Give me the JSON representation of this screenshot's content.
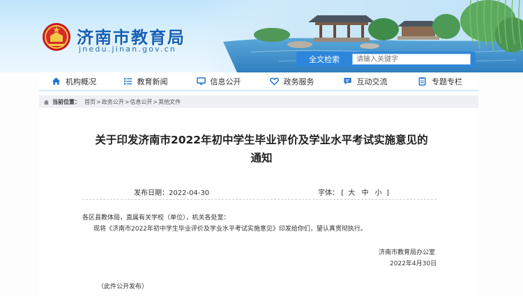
{
  "header": {
    "site_title": "济南市教育局",
    "site_domain": "jnedu.jinan.gov.cn",
    "search_label": "全文检索",
    "search_placeholder": "请输入关键字"
  },
  "nav": {
    "items": [
      {
        "label": "机构概况",
        "icon": "home-icon"
      },
      {
        "label": "教育新闻",
        "icon": "list-icon"
      },
      {
        "label": "信息公开",
        "icon": "monitor-icon"
      },
      {
        "label": "政务服务",
        "icon": "heart-icon"
      },
      {
        "label": "互动交流",
        "icon": "chat-icon"
      },
      {
        "label": "专题专栏",
        "icon": "clipboard-icon"
      }
    ]
  },
  "breadcrumb": {
    "label": "当前位置：",
    "items": [
      "首页",
      "政务公开",
      "信息公开",
      "其他文件"
    ],
    "separator": ">"
  },
  "article": {
    "title_line1": "关于印发济南市2022年初中学生毕业评价及学业水平考试实施意见的",
    "title_line2": "通知",
    "date_label": "发布日期：",
    "date_value": "2022-04-30",
    "font_label": "字体：",
    "font_open": "[",
    "font_large": "大",
    "font_medium": "中",
    "font_small": "小",
    "font_close": "]",
    "salutation": "各区县教体局，直属有关学校（单位），机关各处室：",
    "body": "现将《济南市2022年初中学生毕业评价及学业水平考试实施意见》印发给你们，望认真贯彻执行。",
    "signature": "济南市教育局办公室",
    "sign_date": "2022年4月30日",
    "note": "（此件公开发布）"
  },
  "colors": {
    "title_blue": "#1560b6",
    "search_blue": "#2d86dc",
    "nav_icon_blue": "#1f74d4"
  }
}
